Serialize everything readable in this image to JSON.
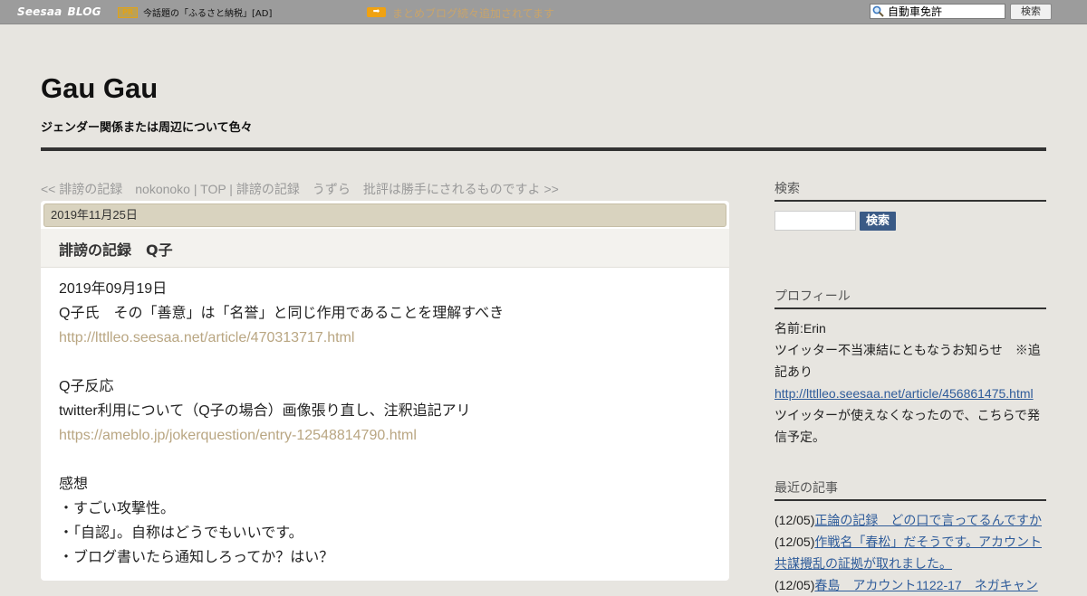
{
  "topbar": {
    "logo_primary": "Seesaa",
    "logo_secondary": "BLOG",
    "pr_badge": "PR",
    "pr_text": "今話題の「ふるさと納税」[AD]",
    "arrow_badge": "➡",
    "promo_link": "まとめブログ続々追加されてます",
    "search_value": "自動車免許",
    "search_button": "検索",
    "colors": {
      "bar": "#9c9c9c",
      "promo_link": "#c9a46a",
      "arrow_badge": "#f0a212"
    }
  },
  "header": {
    "title": "Gau Gau",
    "description": "ジェンダー関係または周辺について色々"
  },
  "nav": {
    "prev": "<< 誹謗の記録　nokonoko",
    "sep1": " | ",
    "top": "TOP",
    "sep2": " | ",
    "next": "誹謗の記録　うずら　批評は勝手にされるものですよ >>"
  },
  "article": {
    "date": "2019年11月25日",
    "title": "誹謗の記録　Q子",
    "lines": [
      {
        "text": "2019年09月19日"
      },
      {
        "text": "Q子氏　その「善意」は「名誉」と同じ作用であることを理解すべき"
      },
      {
        "text": "http://lttlleo.seesaa.net/article/470313717.html",
        "link": true
      },
      {
        "text": ""
      },
      {
        "text": "Q子反応"
      },
      {
        "text": "twitter利用について（Q子の場合）画像張り直し、注釈追記アリ"
      },
      {
        "text": "https://ameblo.jp/jokerquestion/entry-12548814790.html",
        "link": true
      },
      {
        "text": ""
      },
      {
        "text": "感想"
      },
      {
        "text": "・すごい攻撃性。"
      },
      {
        "text": "・「自認」。自称はどうでもいいです。"
      },
      {
        "text": "・ブログ書いたら通知しろってか？はい？"
      }
    ]
  },
  "sidebar": {
    "search": {
      "heading": "検索",
      "button": "検索"
    },
    "profile": {
      "heading": "プロフィール",
      "name": "名前:Erin",
      "notice": "ツイッター不当凍結にともなうお知らせ　※追記あり",
      "link": "http://lttlleo.seesaa.net/article/456861475.html",
      "note": "ツイッターが使えなくなったので、こちらで発信予定。"
    },
    "recent": {
      "heading": "最近の記事",
      "items": [
        {
          "date": "(12/05)",
          "title": "正論の記録　どの口で言ってるんですか"
        },
        {
          "date": "(12/05)",
          "title": "作戦名「春松」だそうです。アカウント共謀攪乱の証拠が取れました。"
        },
        {
          "date": "(12/05)",
          "title": "春島　アカウント1122-17　ネガキャン"
        }
      ]
    }
  }
}
